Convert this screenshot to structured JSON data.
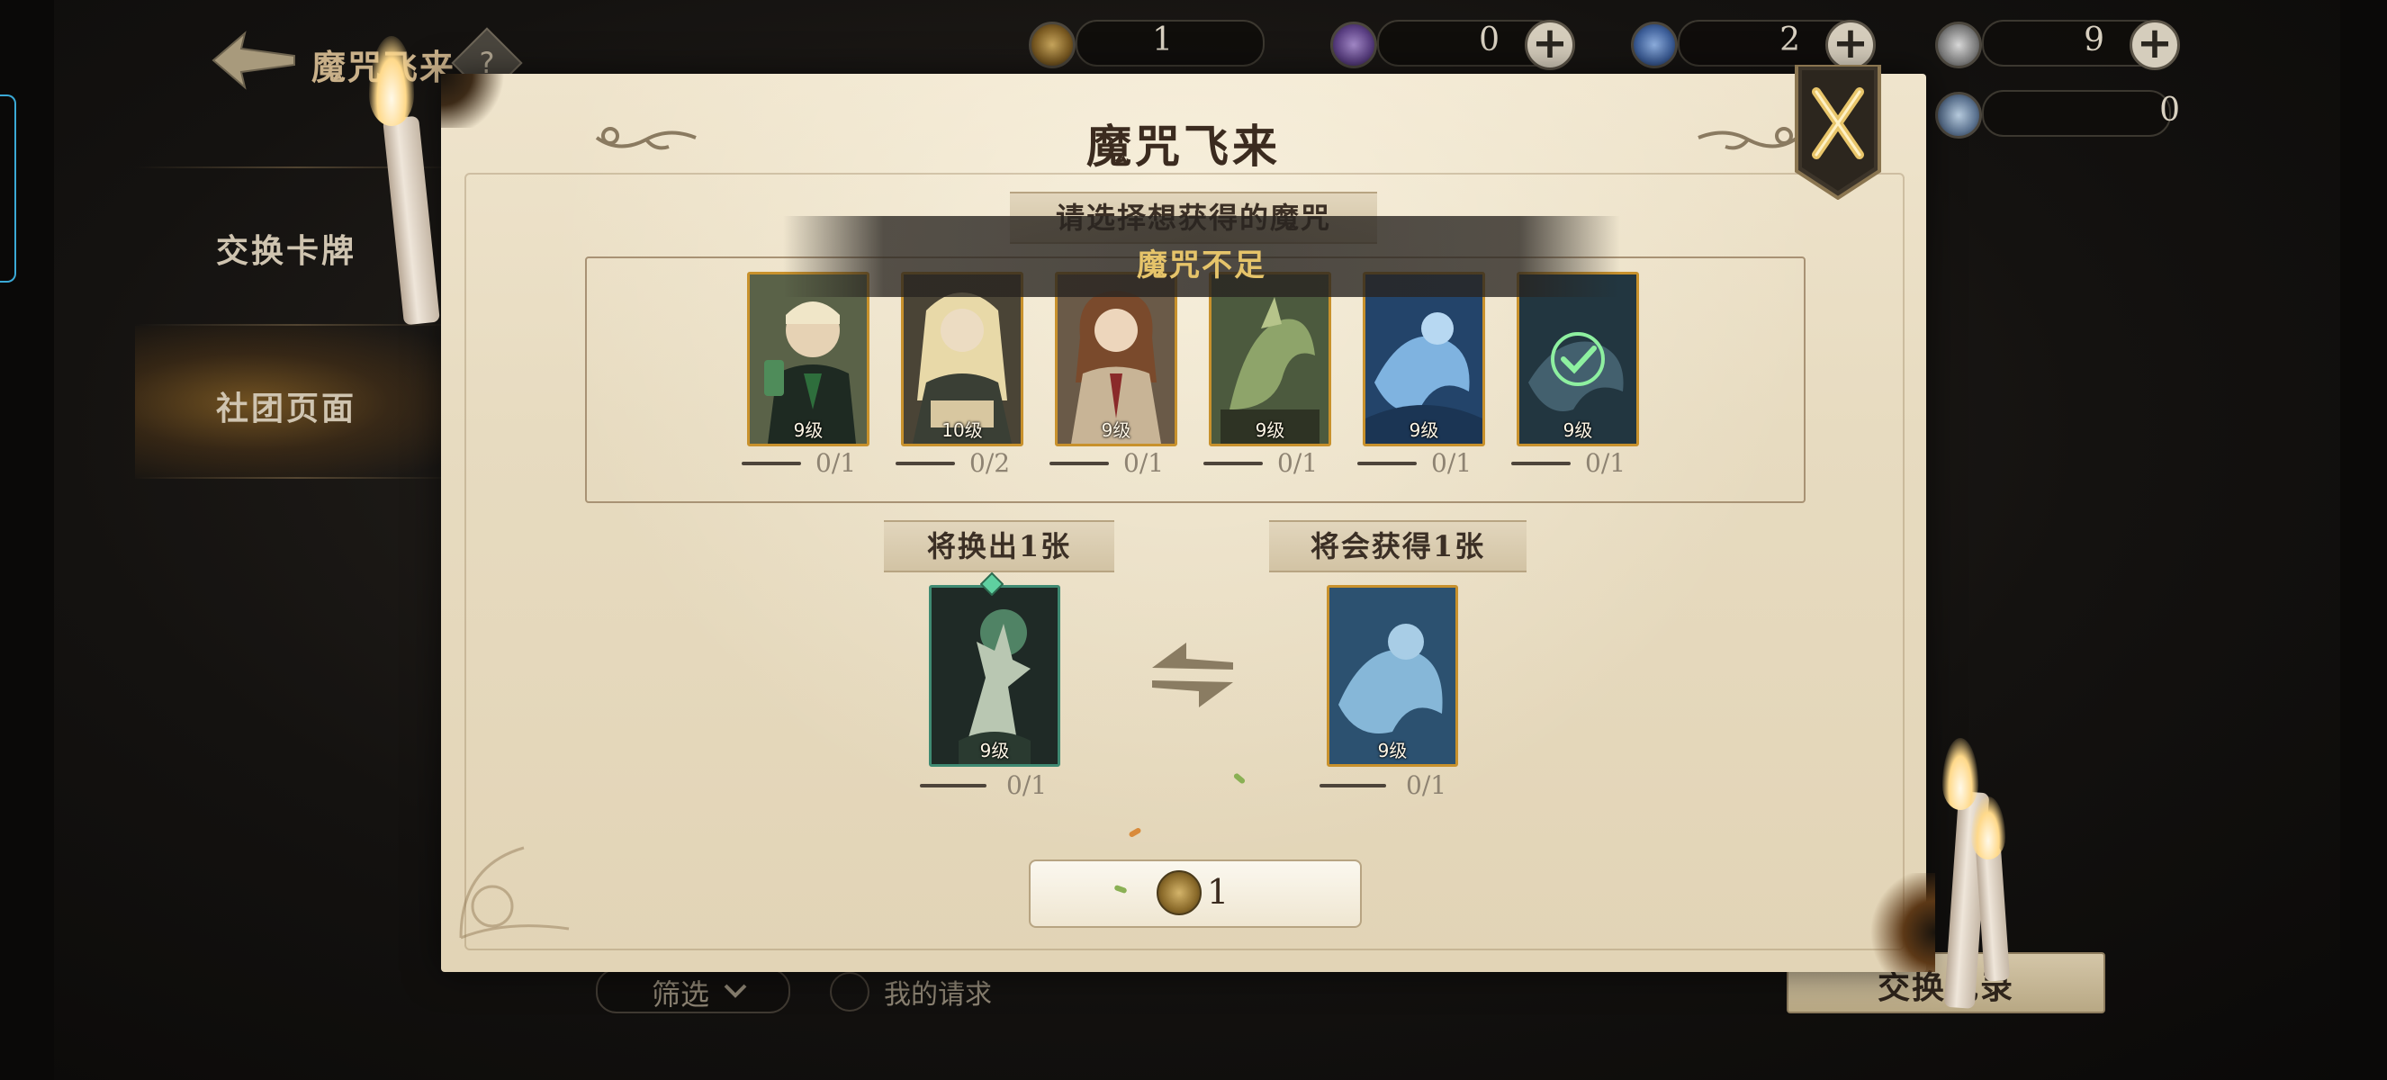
{
  "page": {
    "title": "魔咒飞来",
    "help_symbol": "?"
  },
  "side_menu": {
    "items": [
      {
        "label": "交换卡牌",
        "active": false
      },
      {
        "label": "社团页面",
        "active": true
      }
    ]
  },
  "currencies": [
    {
      "icon": "gold-coin-icon",
      "value": "1",
      "has_plus": false
    },
    {
      "icon": "purple-gem-icon",
      "value": "0",
      "has_plus": true
    },
    {
      "icon": "blue-gem-icon",
      "value": "2",
      "has_plus": true
    },
    {
      "icon": "silver-coin-icon",
      "value": "9",
      "has_plus": true
    },
    {
      "icon": "crystal-icon",
      "value": "0",
      "has_plus": false
    }
  ],
  "dialog": {
    "title": "魔咒飞来",
    "close_symbol": "X",
    "select_banner": "请选择想获得的魔咒",
    "toast": "魔咒不足",
    "cards": [
      {
        "name": "draco-card",
        "level": "9级",
        "count": "0/1"
      },
      {
        "name": "luna-card",
        "level": "10级",
        "count": "0/2"
      },
      {
        "name": "hermione-card",
        "level": "9级",
        "count": "0/1"
      },
      {
        "name": "creature-card",
        "level": "9级",
        "count": "0/1"
      },
      {
        "name": "patronus-card",
        "level": "9级",
        "count": "0/1"
      },
      {
        "name": "selected-card",
        "level": "9级",
        "count": "0/1",
        "selected": true
      }
    ],
    "give_banner": "将换出1张",
    "get_banner": "将会获得1张",
    "give_card": {
      "level": "9级",
      "count": "0/1"
    },
    "get_card": {
      "level": "9级",
      "count": "0/1"
    },
    "cost": {
      "icon": "gold-coin-icon",
      "value": "1"
    }
  },
  "bottom": {
    "filter_label": "筛选",
    "my_request_label": "我的请求",
    "history_label": "交换记录"
  },
  "colors": {
    "parchment": "#e7dbc0",
    "card_border": "#c8912c",
    "toast_text": "#e6c46a",
    "title_text": "#3b2b1f"
  }
}
